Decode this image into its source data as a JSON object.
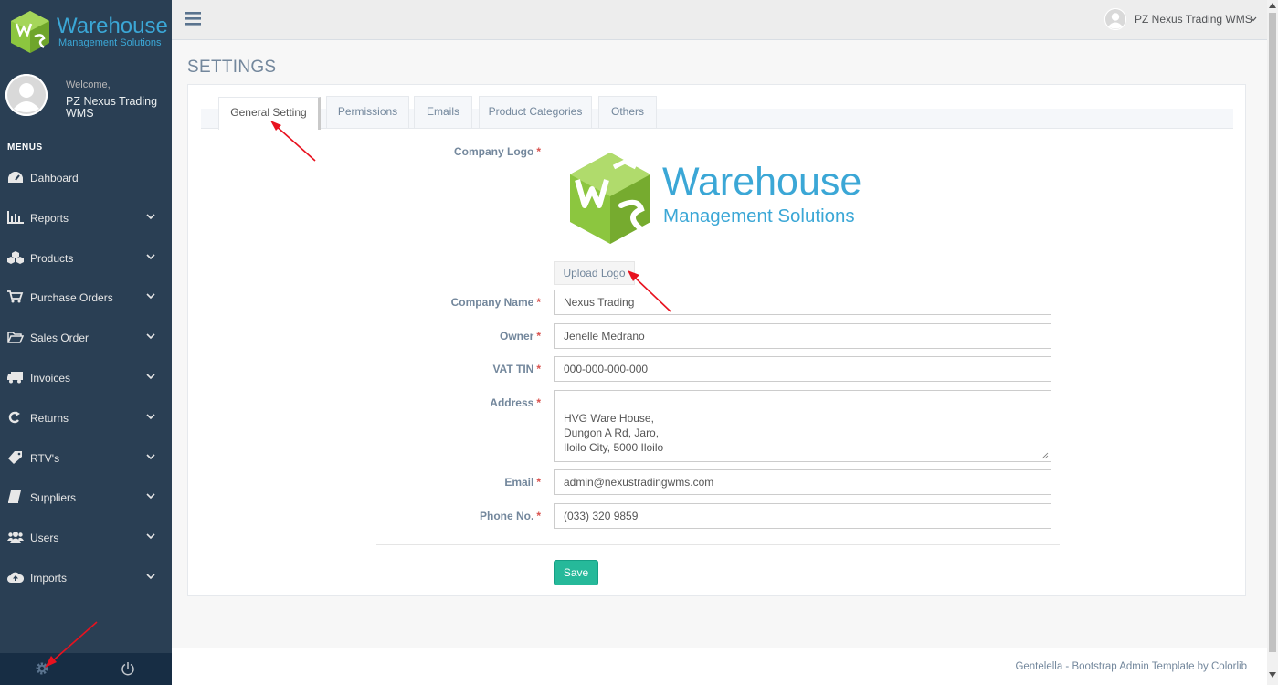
{
  "brand": {
    "title": "Warehouse",
    "subtitle": "Management Solutions"
  },
  "profile": {
    "welcome": "Welcome,",
    "name": "PZ Nexus Trading WMS"
  },
  "sidebar": {
    "menu_title": "MENUS",
    "items": [
      {
        "label": "Dahboard",
        "icon": "dashboard-icon",
        "has_children": false
      },
      {
        "label": "Reports",
        "icon": "bar-chart-icon",
        "has_children": true
      },
      {
        "label": "Products",
        "icon": "cubes-icon",
        "has_children": true
      },
      {
        "label": "Purchase Orders",
        "icon": "cart-icon",
        "has_children": true
      },
      {
        "label": "Sales Order",
        "icon": "folder-open-icon",
        "has_children": true
      },
      {
        "label": "Invoices",
        "icon": "truck-icon",
        "has_children": true
      },
      {
        "label": "Returns",
        "icon": "refresh-icon",
        "has_children": true
      },
      {
        "label": "RTV's",
        "icon": "tag-icon",
        "has_children": true
      },
      {
        "label": "Suppliers",
        "icon": "book-icon",
        "has_children": true
      },
      {
        "label": "Users",
        "icon": "users-icon",
        "has_children": true
      },
      {
        "label": "Imports",
        "icon": "cloud-upload-icon",
        "has_children": true
      }
    ],
    "footer": {
      "settings_icon": "gear-icon",
      "logout_icon": "power-icon"
    }
  },
  "topnav": {
    "user_name": "PZ Nexus Trading WMS"
  },
  "page": {
    "title": "SETTINGS"
  },
  "tabs": [
    {
      "label": "General Setting",
      "active": true
    },
    {
      "label": "Permissions",
      "active": false
    },
    {
      "label": "Emails",
      "active": false
    },
    {
      "label": "Product Categories",
      "active": false
    },
    {
      "label": "Others",
      "active": false
    }
  ],
  "form": {
    "company_logo_label": "Company Logo",
    "logo_title": "Warehouse",
    "logo_subtitle": "Management Solutions",
    "upload_label": "Upload Logo",
    "company_name_label": "Company Name",
    "company_name_value": "Nexus Trading",
    "owner_label": "Owner",
    "owner_value": "Jenelle Medrano",
    "vat_label": "VAT TIN",
    "vat_value": "000-000-000-000",
    "address_label": "Address",
    "address_value": "HVG Ware House,\nDungon A Rd, Jaro,\nIloilo City, 5000 Iloilo",
    "email_label": "Email",
    "email_value": "admin@nexustradingwms.com",
    "phone_label": "Phone No.",
    "phone_value": "(033) 320 9859",
    "required_mark": "*",
    "save_label": "Save"
  },
  "footer": {
    "text": "Gentelella - Bootstrap Admin Template by Colorlib"
  },
  "colors": {
    "sidebar": "#2a3f54",
    "accent_green": "#26b99a",
    "brand_blue": "#3ba7d6",
    "logo_green": "#8cc63f",
    "arrow_red": "#e8121f"
  }
}
